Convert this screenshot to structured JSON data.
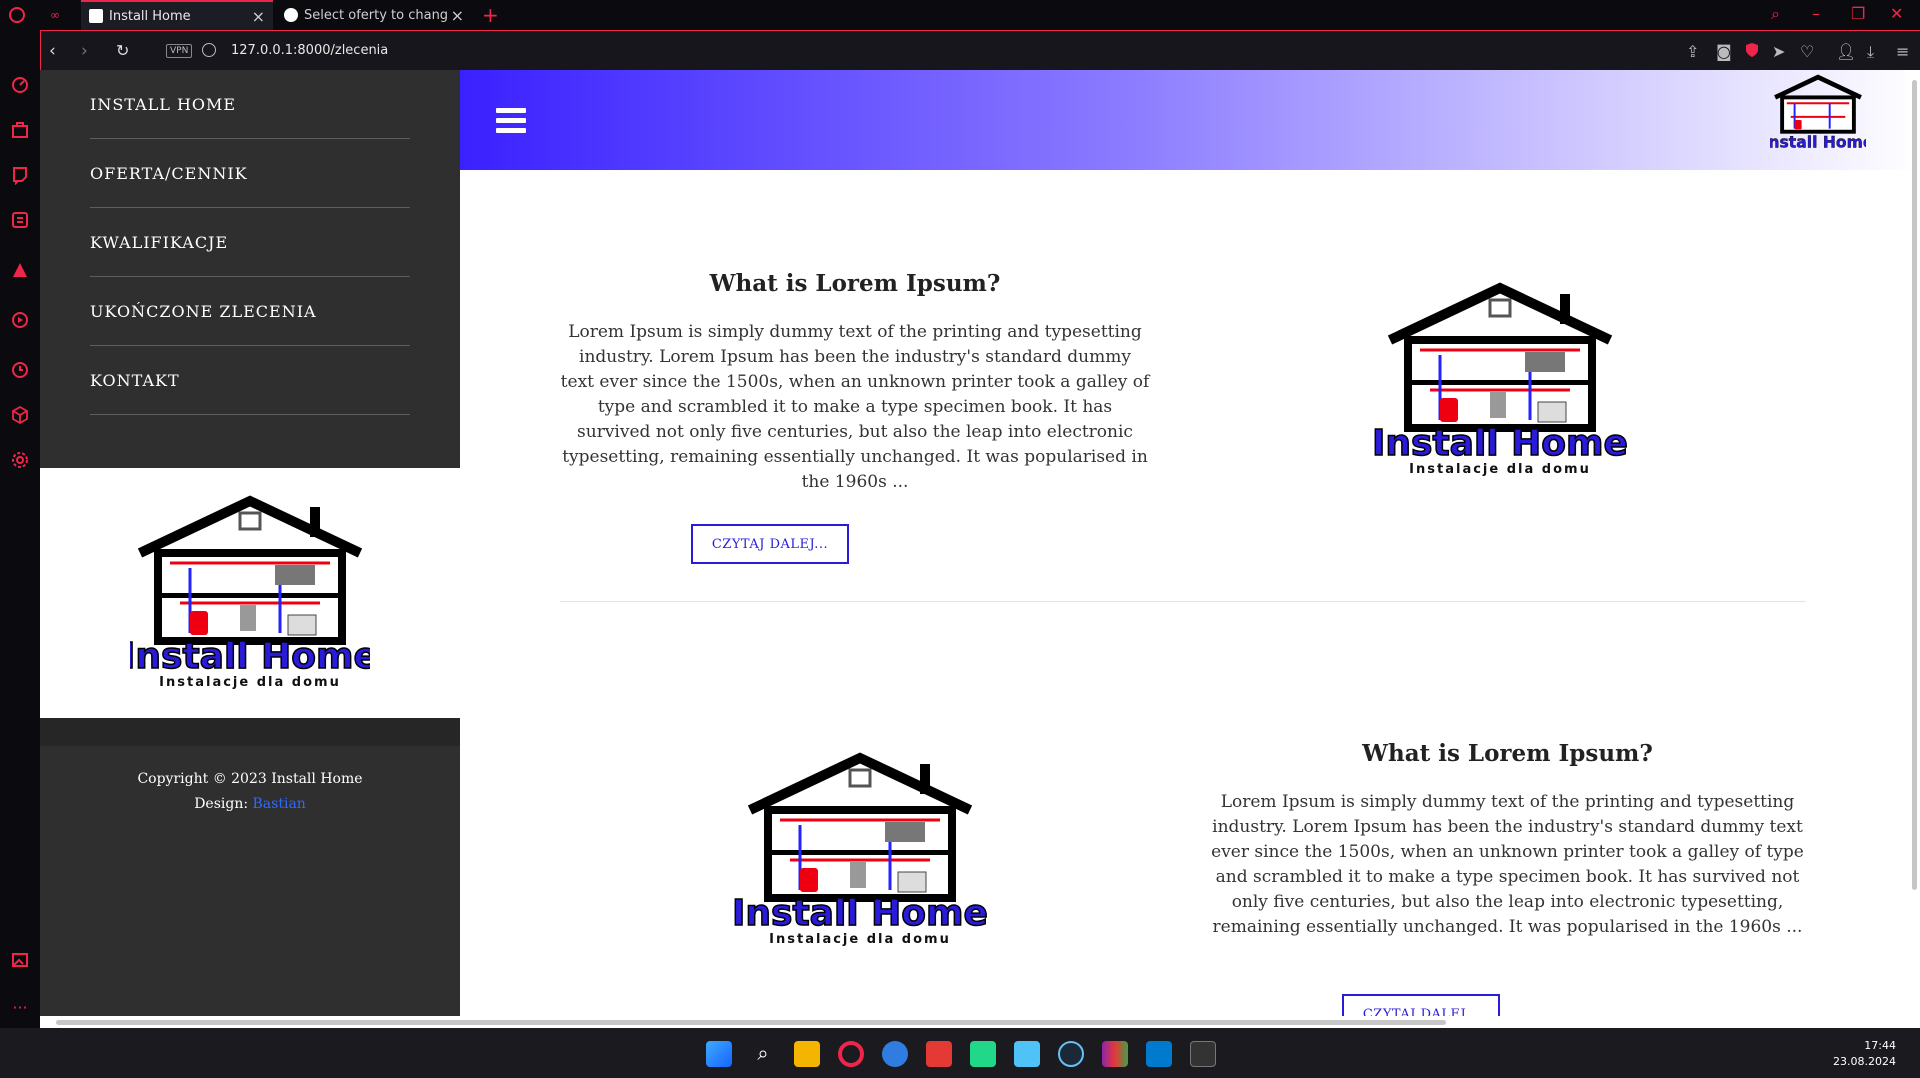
{
  "browser": {
    "tabs": [
      {
        "label": "Install Home",
        "active": true
      },
      {
        "label": "Select oferty to change | D",
        "active": false
      }
    ],
    "vpn_label": "VPN",
    "url": "127.0.0.1:8000/zlecenia",
    "accent_color": "#f0254a"
  },
  "site": {
    "menu": [
      {
        "label": "INSTALL HOME"
      },
      {
        "label": "OFERTA/CENNIK"
      },
      {
        "label": "KWALIFIKACJE"
      },
      {
        "label": "UKOŃCZONE ZLECENIA"
      },
      {
        "label": "KONTAKT"
      }
    ],
    "logo": {
      "title": "Install Home",
      "subtitle": "Instalacje dla domu"
    },
    "footer": {
      "copyright": "Copyright © 2023 Install Home",
      "design_label": "Design:",
      "design_author": "Bastian"
    },
    "posts": [
      {
        "title": "What is Lorem Ipsum?",
        "text": "Lorem Ipsum is simply dummy text of the printing and typesetting industry. Lorem Ipsum has been the industry's standard dummy text ever since the 1500s, when an unknown printer took a galley of type and scrambled it to make a type specimen book. It has survived not only five centuries, but also the leap into electronic typesetting, remaining essentially unchanged. It was popularised in the 1960s ...",
        "button": "CZYTAJ DALEJ..."
      },
      {
        "title": "What is Lorem Ipsum?",
        "text": "Lorem Ipsum is simply dummy text of the printing and typesetting industry. Lorem Ipsum has been the industry's standard dummy text ever since the 1500s, when an unknown printer took a galley of type and scrambled it to make a type specimen book. It has survived not only five centuries, but also the leap into electronic typesetting, remaining essentially unchanged. It was popularised in the 1960s ...",
        "button": "CZYTAJ DALEJ..."
      }
    ],
    "brand_color": "#2a1bd8"
  },
  "taskbar": {
    "time": "17:44",
    "date": "23.08.2024",
    "apps": [
      "start-icon",
      "search-icon",
      "file-explorer-icon",
      "opera-icon",
      "app-icon",
      "snipping-icon",
      "pycharm-icon",
      "notepad-icon",
      "steam-icon",
      "winrar-icon",
      "vscode-icon",
      "terminal-icon"
    ]
  }
}
